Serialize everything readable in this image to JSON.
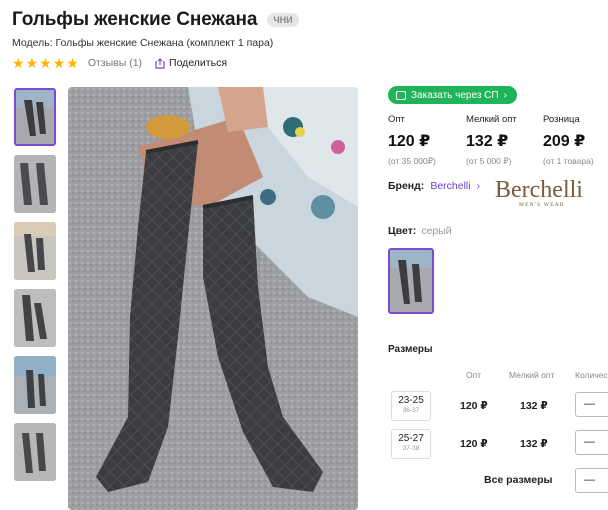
{
  "product": {
    "title": "Гольфы женские Снежана",
    "badge": "ЧНИ",
    "model_line": "Модель: Гольфы женские Снежана (комплект 1 пара)",
    "rating_stars": 5,
    "reviews_label": "Отзывы (1)",
    "share_label": "Поделиться"
  },
  "order_button": {
    "label": "Заказать через СП"
  },
  "prices": [
    {
      "label": "Опт",
      "value": "120 ₽",
      "note": "(от 35 000₽)"
    },
    {
      "label": "Мелкий опт",
      "value": "132 ₽",
      "note": "(от 5 000 ₽)"
    },
    {
      "label": "Розница",
      "value": "209 ₽",
      "note": "(от 1 товара)"
    }
  ],
  "brand": {
    "label": "Бренд:",
    "name": "Berchelli",
    "logo_text": "Berchelli",
    "logo_sub": "MEN'S WEAR"
  },
  "color": {
    "label": "Цвет:",
    "value": "серый"
  },
  "sizes": {
    "title": "Размеры",
    "columns": [
      "Опт",
      "Мелкий опт",
      "Количес"
    ],
    "rows": [
      {
        "size": "23-25",
        "sub": "36-37",
        "opt": "120 ₽",
        "small_opt": "132 ₽",
        "qty": "—"
      },
      {
        "size": "25-27",
        "sub": "37-38",
        "opt": "120 ₽",
        "small_opt": "132 ₽",
        "qty": "—"
      }
    ],
    "all_label": "Все размеры",
    "all_qty": "—"
  },
  "colors": {
    "accent": "#7b4bd6",
    "green": "#1fb45a",
    "star": "#ffb400"
  }
}
